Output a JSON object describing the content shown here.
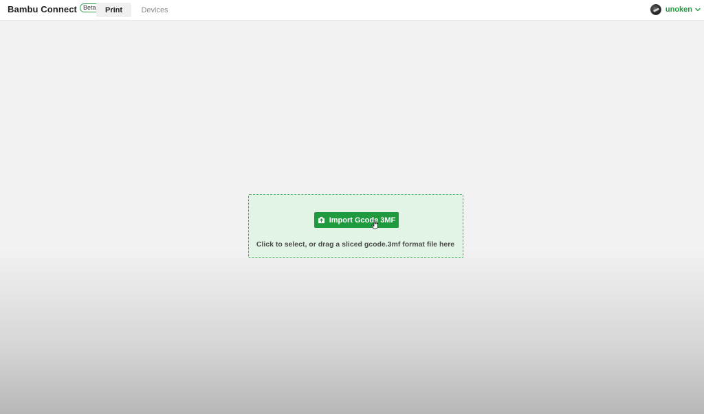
{
  "app": {
    "title": "Bambu Connect",
    "badge": "Beta"
  },
  "nav": {
    "tabs": [
      {
        "label": "Print",
        "active": true
      },
      {
        "label": "Devices",
        "active": false
      }
    ]
  },
  "user": {
    "name": "unoken"
  },
  "dropzone": {
    "button_label": "Import Gcode 3MF",
    "hint": "Click to select, or drag a sliced gcode.3mf format file here"
  },
  "colors": {
    "accent": "#1f9a3e",
    "dropzone_bg": "#e2f4e6",
    "dropzone_border": "#35a852"
  },
  "icons": {
    "import": "upload-icon",
    "user_menu": "chevron-down-icon",
    "cursor": "hand-cursor-icon"
  }
}
